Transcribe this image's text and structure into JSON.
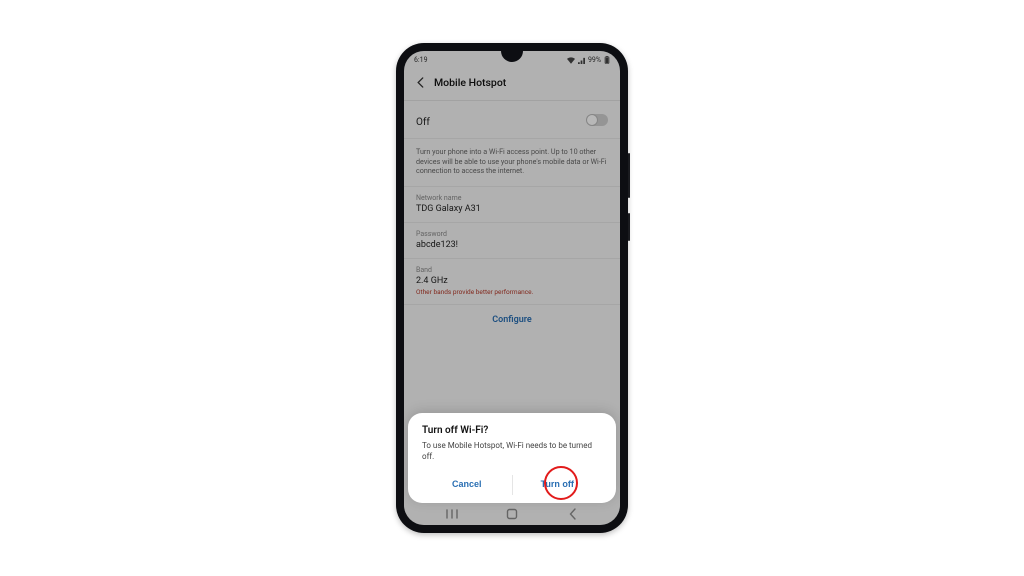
{
  "status": {
    "time": "6:19",
    "battery": "99%"
  },
  "appbar": {
    "title": "Mobile Hotspot"
  },
  "toggle": {
    "state_label": "Off"
  },
  "description": "Turn your phone into a Wi-Fi access point. Up to 10 other devices will be able to use your phone's mobile data or Wi-Fi connection to access the internet.",
  "fields": {
    "network_name": {
      "label": "Network name",
      "value": "TDG Galaxy A31"
    },
    "password": {
      "label": "Password",
      "value": "abcde123!"
    },
    "band": {
      "label": "Band",
      "value": "2.4 GHz",
      "hint": "Other bands provide better performance."
    }
  },
  "configure_label": "Configure",
  "dialog": {
    "title": "Turn off Wi-Fi?",
    "body": "To use Mobile Hotspot, Wi-Fi needs to be turned off.",
    "cancel": "Cancel",
    "confirm": "Turn off"
  }
}
